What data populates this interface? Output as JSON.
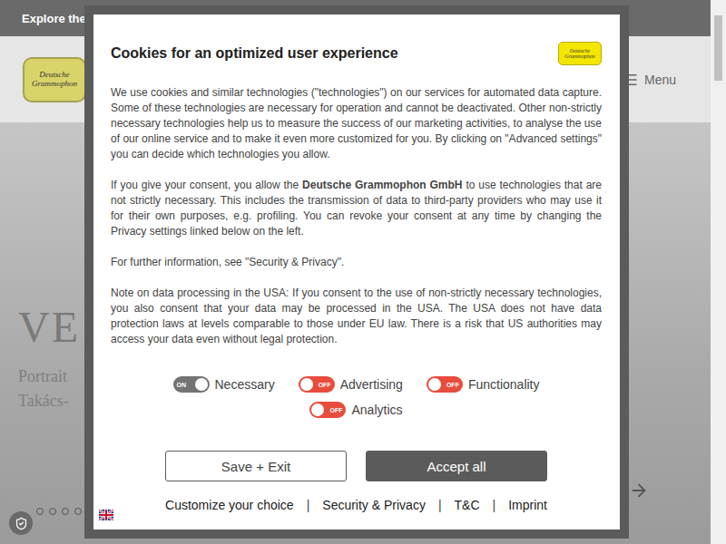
{
  "page": {
    "top_bar_text": "Explore the",
    "logo_lines": [
      "Deutsche",
      "Grammophon"
    ],
    "menu_label": "Menu",
    "hero_title": "VE",
    "hero_lines": [
      "Portrait",
      "Takács-"
    ],
    "carousel_dots": [
      {
        "selected": false
      },
      {
        "selected": false
      },
      {
        "selected": false
      },
      {
        "selected": false
      }
    ]
  },
  "dialog": {
    "title": "Cookies for an optimized user experience",
    "logo_lines": [
      "Deutsche",
      "Grammophon"
    ],
    "paragraphs": [
      {
        "before": "We use cookies and similar technologies (\"technologies\") on our services for automated data capture. Some of these technologies are necessary for operation and cannot be deactivated. Other non-strictly necessary technologies help us to measure the success of our marketing activities, to analyse the use of our online service and to make it even more customized for you. By clicking on \"Advanced settings\" you can decide which technologies you allow.",
        "bold": "",
        "after": ""
      },
      {
        "before": "If you give your consent, you allow the ",
        "bold": "Deutsche Grammophon GmbH",
        "after": " to use technologies that are not strictly necessary. This includes the transmission of data to third-party providers who may use it for their own purposes, e.g. profiling. You can revoke your consent at any time by changing the Privacy settings linked below on the left."
      },
      {
        "before": "For further information, see \"Security & Privacy\".",
        "bold": "",
        "after": ""
      },
      {
        "before": "Note on data processing in the USA: If you consent to the use of non-strictly necessary technologies, you also consent that your data may be processed in the USA. The USA does not have data protection laws at levels comparable to those under EU law. There is a risk that US authorities may access your data even without legal protection.",
        "bold": "",
        "after": ""
      }
    ],
    "toggles": [
      {
        "label": "Necessary",
        "on": true,
        "badge": "ON"
      },
      {
        "label": "Advertising",
        "on": false,
        "badge": "OFF"
      },
      {
        "label": "Functionality",
        "on": false,
        "badge": "OFF"
      },
      {
        "label": "Analytics",
        "on": false,
        "badge": "OFF"
      }
    ],
    "buttons": [
      {
        "label": "Save + Exit",
        "primary": false
      },
      {
        "label": "Accept all",
        "primary": true
      }
    ],
    "links": [
      "Customize your choice",
      "Security & Privacy",
      "T&C",
      "Imprint"
    ],
    "separator": "|"
  }
}
